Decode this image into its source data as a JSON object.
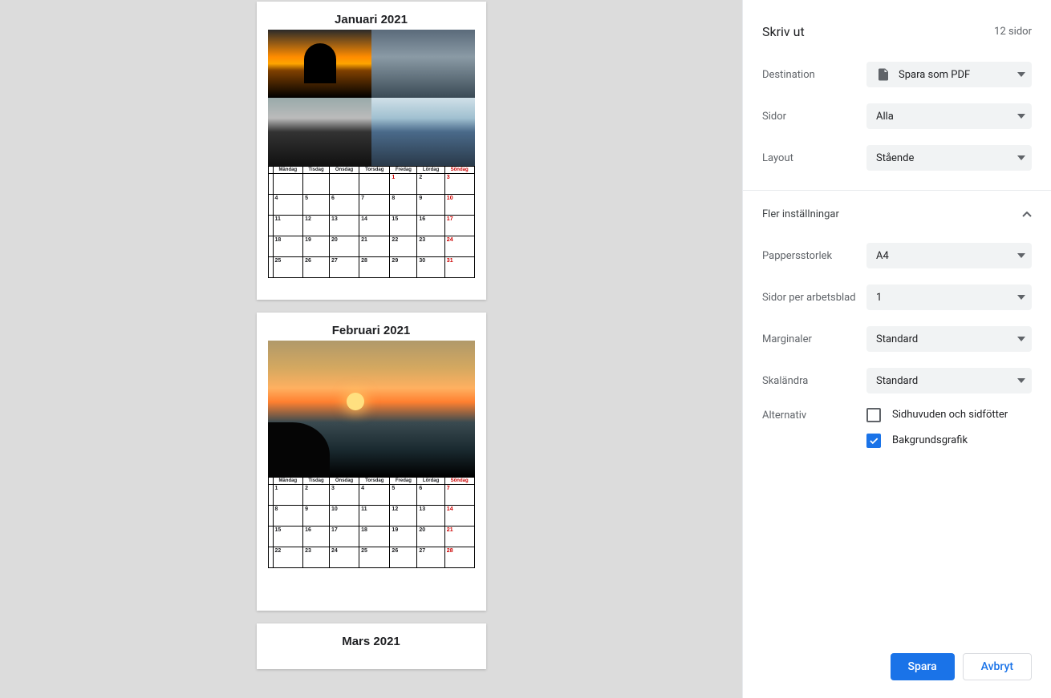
{
  "preview": {
    "pages": [
      {
        "title": "Januari 2021"
      },
      {
        "title": "Februari 2021"
      },
      {
        "title": "Mars 2021"
      }
    ],
    "days": [
      "Måndag",
      "Tisdag",
      "Onsdag",
      "Torsdag",
      "Fredag",
      "Lördag",
      "Söndag"
    ],
    "jan_weeks": [
      {
        "days": [
          "",
          "",
          "",
          "",
          "1",
          "2",
          "3"
        ],
        "red": [
          4,
          6
        ]
      },
      {
        "days": [
          "4",
          "5",
          "6",
          "7",
          "8",
          "9",
          "10"
        ],
        "red": [
          6
        ]
      },
      {
        "days": [
          "11",
          "12",
          "13",
          "14",
          "15",
          "16",
          "17"
        ],
        "red": [
          6
        ]
      },
      {
        "days": [
          "18",
          "19",
          "20",
          "21",
          "22",
          "23",
          "24"
        ],
        "red": [
          6
        ]
      },
      {
        "days": [
          "25",
          "26",
          "27",
          "28",
          "29",
          "30",
          "31"
        ],
        "red": [
          6
        ]
      }
    ],
    "feb_weeks": [
      {
        "days": [
          "1",
          "2",
          "3",
          "4",
          "5",
          "6",
          "7"
        ],
        "red": [
          6
        ]
      },
      {
        "days": [
          "8",
          "9",
          "10",
          "11",
          "12",
          "13",
          "14"
        ],
        "red": [
          6
        ]
      },
      {
        "days": [
          "15",
          "16",
          "17",
          "18",
          "19",
          "20",
          "21"
        ],
        "red": [
          6
        ]
      },
      {
        "days": [
          "22",
          "23",
          "24",
          "25",
          "26",
          "27",
          "28"
        ],
        "red": [
          6
        ]
      }
    ]
  },
  "panel": {
    "title": "Skriv ut",
    "count": "12 sidor",
    "destination_label": "Destination",
    "destination_value": "Spara som PDF",
    "pages_label": "Sidor",
    "pages_value": "Alla",
    "layout_label": "Layout",
    "layout_value": "Stående",
    "more_label": "Fler inställningar",
    "paper_label": "Pappersstorlek",
    "paper_value": "A4",
    "per_sheet_label": "Sidor per arbetsblad",
    "per_sheet_value": "1",
    "margins_label": "Marginaler",
    "margins_value": "Standard",
    "scale_label": "Skaländra",
    "scale_value": "Standard",
    "options_label": "Alternativ",
    "opt_headers": "Sidhuvuden och sidfötter",
    "opt_bg": "Bakgrundsgrafik",
    "save_btn": "Spara",
    "cancel_btn": "Avbryt"
  }
}
